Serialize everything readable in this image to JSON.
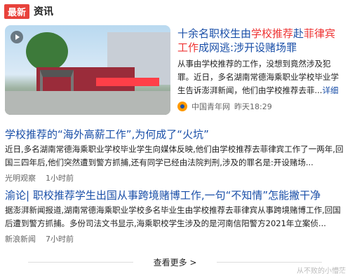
{
  "header": {
    "tag": "最新",
    "title": "资讯"
  },
  "news": [
    {
      "title_parts": [
        "十余名职校生由",
        "学校推荐",
        "赴",
        "菲律宾工作",
        "成网逃:涉开设赌场罪"
      ],
      "summary": "从事由学校推荐的工作，没想到竟然涉及犯罪。近日，多名湖南常德海乘职业学校毕业学生告诉澎湃新闻，他们由学校推荐去菲...",
      "summary_more": "详细",
      "source": "中国青年网",
      "time": "昨天18:29"
    },
    {
      "title": "学校推荐的“海外高薪工作”,为何成了“火坑”",
      "summary": "近日,多名湖南常德海乘职业学校毕业学生向媒体反映,他们由学校推荐去菲律宾工作了一两年,回国三四年后,他们突然遭到警方抓捕,还有同学已经由法院判刑,涉及的罪名是:开设赌场...",
      "source": "光明观察",
      "time": "1小时前"
    },
    {
      "title": "渝论| 职校推荐学生出国从事跨境赌博工作,一句“不知情”怎能撇干净",
      "summary": "据澎湃新闻报道,湖南常德海乘职业学校多名毕业生由学校推荐去菲律宾从事跨境赌博工作,回国后遭到警方抓捕。多份司法文书显示,海乘职校学生涉及的是河南信阳警方2021年立案侦...",
      "source": "新浪新闻",
      "time": "7小时前"
    }
  ],
  "view_more": "查看更多 >",
  "watermark": "从不败的小懵茫"
}
